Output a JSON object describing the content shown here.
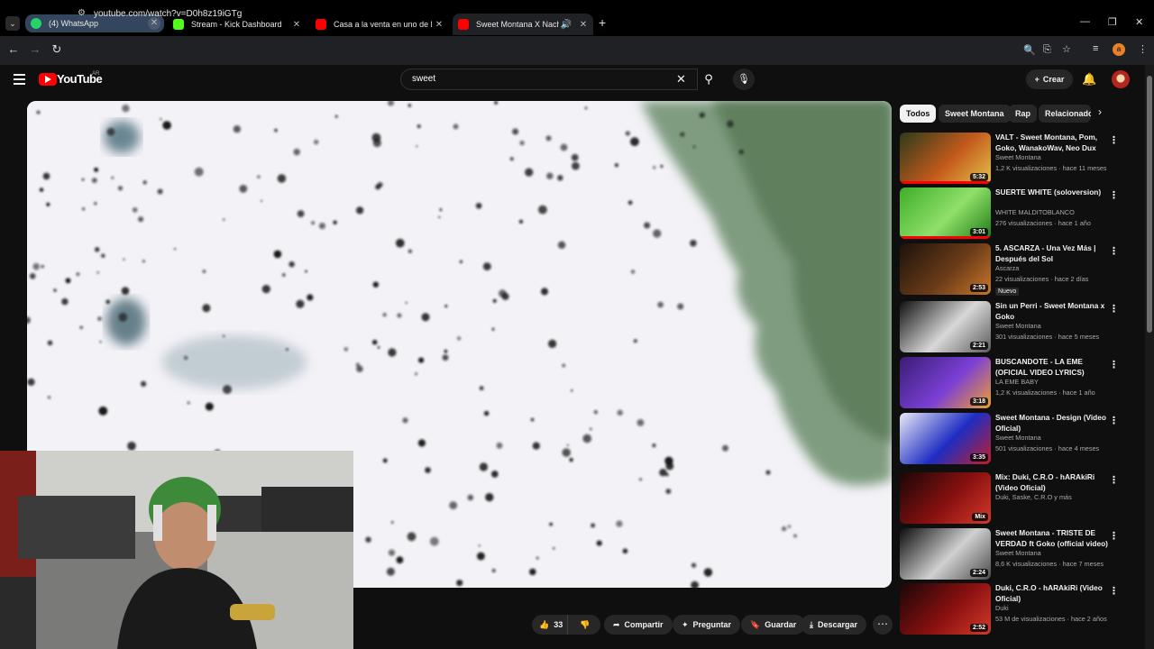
{
  "browser": {
    "tabs": [
      {
        "title": "(4) WhatsApp",
        "color": "#25d366"
      },
      {
        "title": "Stream - Kick Dashboard",
        "color": "#53fc18"
      },
      {
        "title": "Casa a la venta en uno de los b",
        "color": "#ff0000"
      },
      {
        "title": "Sweet Montana X Nacho R",
        "color": "#ff0000"
      }
    ],
    "url": "youtube.com/watch?v=D0h8z19iGTg",
    "profile_initial": "a"
  },
  "youtube": {
    "logo_text": "YouTube",
    "country": "AR",
    "search_value": "sweet",
    "create_label": "Crear"
  },
  "actions": {
    "like_count": "33",
    "share": "Compartir",
    "ask": "Preguntar",
    "save": "Guardar",
    "download": "Descargar"
  },
  "chips": [
    "Todos",
    "Sweet Montana",
    "Rap",
    "Relacionado"
  ],
  "recommendations": [
    {
      "title": "VALT - Sweet Montana, Pom, Goko, WanakoWav, Neo Dux",
      "channel": "Sweet Montana",
      "meta": "1,2 K visualizaciones · hace 11 meses",
      "duration": "5:32",
      "progress": 1.0,
      "thumb_colors": [
        "#2c3b1a",
        "#c45a1c",
        "#e3c34b"
      ]
    },
    {
      "title": "SUERTE   WHITE (soloversion)",
      "channel": "WHITE MALDITOBLANCO",
      "meta": "276 visualizaciones · hace 1 año",
      "duration": "3:01",
      "progress": 1.0,
      "thumb_colors": [
        "#3fae2a",
        "#8fe06a",
        "#1e7a15"
      ]
    },
    {
      "title": "5. ASCARZA - Una Vez Más | Después del Sol",
      "channel": "Ascarza",
      "meta": "22 visualizaciones · hace 2 días",
      "badge": "Nuevo",
      "duration": "2:53",
      "progress": 0,
      "thumb_colors": [
        "#1b120c",
        "#6b3b18",
        "#c9772b"
      ]
    },
    {
      "title": "Sin un Perri - Sweet Montana x Goko",
      "channel": "Sweet Montana",
      "meta": "301 visualizaciones · hace 5 meses",
      "duration": "2:21",
      "progress": 0,
      "thumb_colors": [
        "#101010",
        "#d8d8d8",
        "#5a5a5a"
      ]
    },
    {
      "title": "BUSCANDOTE - LA EME (OFICIAL VIDEO LYRICS)",
      "channel": "LA EME BABY",
      "meta": "1,2 K visualizaciones · hace 1 año",
      "duration": "3:18",
      "progress": 0,
      "thumb_colors": [
        "#3a1d74",
        "#7a3fd6",
        "#f0a030"
      ]
    },
    {
      "title": "Sweet Montana - Design (Video Oficial)",
      "channel": "Sweet Montana",
      "meta": "501 visualizaciones · hace 4 meses",
      "duration": "3:35",
      "progress": 0,
      "thumb_colors": [
        "#e9e9f5",
        "#1e2dc2",
        "#c21e2d"
      ]
    },
    {
      "title": "Mix: Duki, C.R.O - hARAkiRi (Video Oficial)",
      "channel": "Duki, Saske, C.R.O y más",
      "meta": "",
      "duration": "Mix",
      "progress": 0,
      "thumb_colors": [
        "#1a0707",
        "#8a1010",
        "#d23a2a"
      ]
    },
    {
      "title": "Sweet Montana - TRISTE DE VERDAD ft Goko (official video)",
      "channel": "Sweet Montana",
      "meta": "8,6 K visualizaciones · hace 7 meses",
      "duration": "2:24",
      "progress": 0,
      "thumb_colors": [
        "#0c0c0c",
        "#d0d0d0",
        "#4a4a4a"
      ]
    },
    {
      "title": "Duki, C.R.O - hARAkiRi (Video Oficial)",
      "channel": "Duki",
      "meta": "53 M de visualizaciones · hace 2 años",
      "duration": "2:52",
      "progress": 0,
      "thumb_colors": [
        "#1a0707",
        "#8a1010",
        "#d23a2a"
      ]
    }
  ]
}
